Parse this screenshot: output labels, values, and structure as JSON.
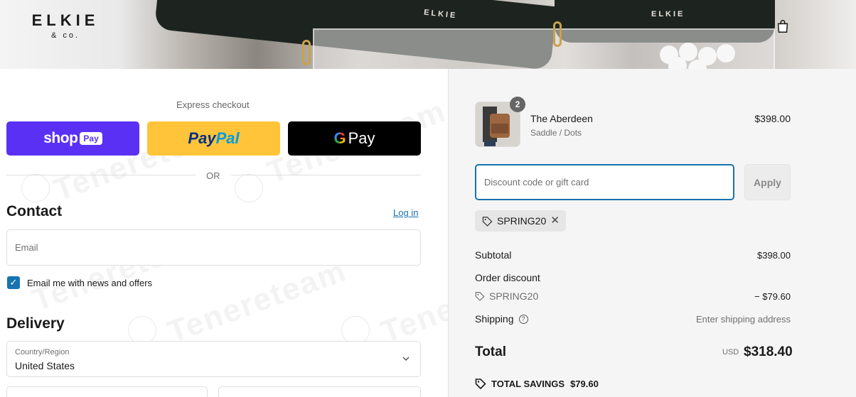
{
  "header": {
    "logo_line1": "ELKIE",
    "logo_line2": "& co.",
    "bag_logo": "ELKIE",
    "cart_icon": "shopping-bag-icon"
  },
  "express": {
    "title": "Express checkout",
    "shop_label": "shop",
    "shop_pay_pill": "Pay",
    "paypal_part1": "Pay",
    "paypal_part2": "Pal",
    "gpay_g": "G",
    "gpay_label": "Pay",
    "or_text": "OR"
  },
  "contact": {
    "heading": "Contact",
    "login_link": "Log in",
    "email_placeholder": "Email",
    "newsletter_label": "Email me with news and offers",
    "newsletter_checked": true
  },
  "delivery": {
    "heading": "Delivery",
    "country_label": "Country/Region",
    "country_value": "United States"
  },
  "order": {
    "item": {
      "name": "The Aberdeen",
      "variant": "Saddle / Dots",
      "price": "$398.00",
      "quantity": "2"
    },
    "discount_placeholder": "Discount code or gift card",
    "apply_label": "Apply",
    "applied_code": "SPRING20",
    "subtotal_label": "Subtotal",
    "subtotal_value": "$398.00",
    "order_discount_label": "Order discount",
    "discount_code": "SPRING20",
    "discount_value": "− $79.60",
    "shipping_label": "Shipping",
    "shipping_value": "Enter shipping address",
    "total_label": "Total",
    "currency": "USD",
    "total_value": "$318.40",
    "savings_label": "TOTAL SAVINGS",
    "savings_value": "$79.60"
  },
  "watermark": "Tenereteam",
  "colors": {
    "shop_pay": "#5a31f4",
    "paypal": "#ffc439",
    "gpay": "#000000",
    "accent_link": "#1773b0",
    "summary_bg": "#f5f5f5"
  }
}
